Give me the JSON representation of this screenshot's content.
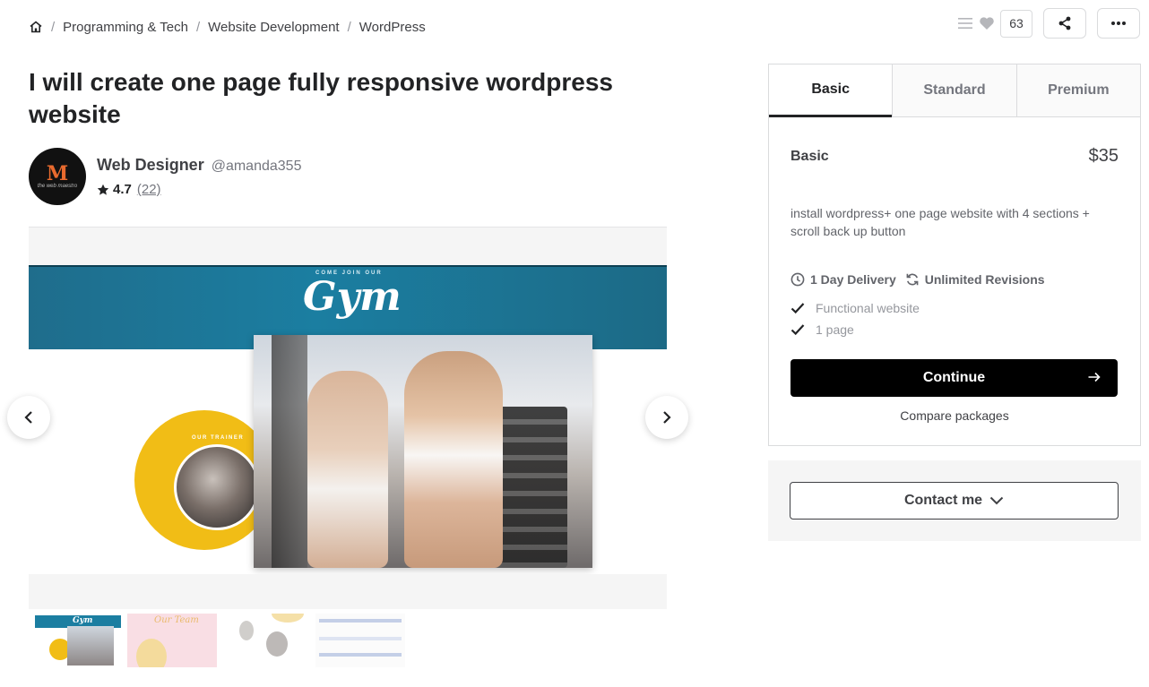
{
  "breadcrumb": {
    "items": [
      "Programming & Tech",
      "Website Development",
      "WordPress"
    ],
    "separator": "/"
  },
  "top_actions": {
    "likes_count": "63"
  },
  "gig": {
    "title": "I will create one page fully responsive wordpress website"
  },
  "seller": {
    "name": "Web Designer",
    "handle": "@amanda355",
    "rating": "4.7",
    "reviews": "(22)",
    "avatar_logo": "M",
    "avatar_sub": "the web maestro"
  },
  "gallery": {
    "slide_kicker": "COME JOIN OUR",
    "slide_title": "Gym",
    "slide_trainer_label": "OUR TRAINER",
    "thumb_2_title": "Our Team",
    "thumb_1_title": "Gym"
  },
  "packages": {
    "tabs": [
      "Basic",
      "Standard",
      "Premium"
    ],
    "active_tab": "Basic",
    "name": "Basic",
    "price": "$35",
    "description": "install wordpress+ one page website with 4 sections + scroll back up button",
    "delivery": "1 Day Delivery",
    "revisions": "Unlimited Revisions",
    "features": [
      "Functional website",
      "1 page"
    ],
    "continue_label": "Continue",
    "compare_label": "Compare packages"
  },
  "contact": {
    "label": "Contact me"
  },
  "colors": {
    "primary_text": "#404145",
    "cta_bg": "#000000",
    "gym_banner": "#1b7ea1",
    "accent_yellow": "#f1bd16"
  }
}
